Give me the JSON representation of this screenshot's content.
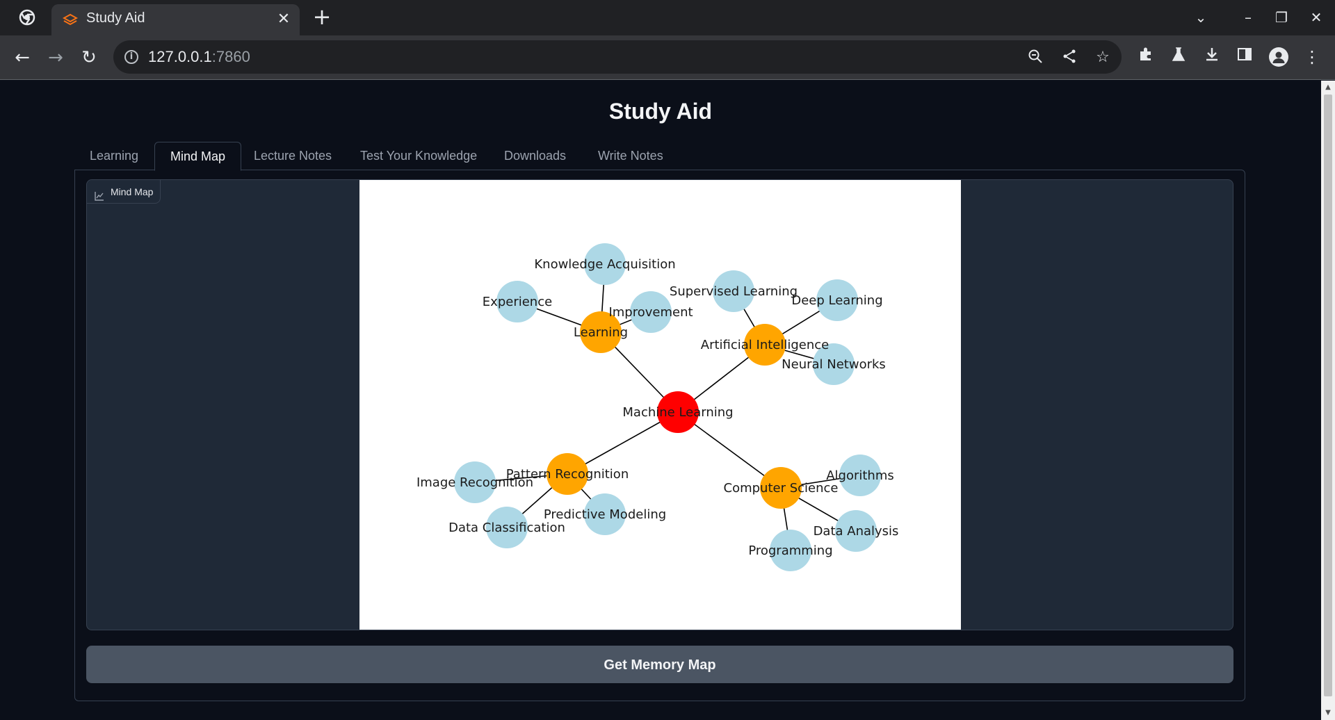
{
  "browser": {
    "tab_title": "Study Aid",
    "tab_close": "✕",
    "new_tab": "+",
    "url_host": "127.0.0.1",
    "url_port": ":7860"
  },
  "app": {
    "title": "Study Aid",
    "tabs": [
      {
        "label": "Learning"
      },
      {
        "label": "Mind Map",
        "active": true
      },
      {
        "label": "Lecture Notes"
      },
      {
        "label": "Test Your Knowledge"
      },
      {
        "label": "Downloads"
      },
      {
        "label": "Write Notes"
      }
    ],
    "plot_label": "Mind Map",
    "button_label": "Get Memory Map"
  },
  "mind_map": {
    "colors": {
      "root": "#ff0000",
      "branch": "#ffa500",
      "leaf": "#add8e6",
      "edge": "#000000"
    },
    "nodes": [
      {
        "id": "ml",
        "label": "Machine Learning",
        "level": "root"
      },
      {
        "id": "learning",
        "label": "Learning",
        "level": "branch"
      },
      {
        "id": "ai",
        "label": "Artificial Intelligence",
        "level": "branch"
      },
      {
        "id": "pr",
        "label": "Pattern Recognition",
        "level": "branch"
      },
      {
        "id": "cs",
        "label": "Computer Science",
        "level": "branch"
      },
      {
        "id": "ka",
        "label": "Knowledge Acquisition",
        "level": "leaf"
      },
      {
        "id": "exp",
        "label": "Experience",
        "level": "leaf"
      },
      {
        "id": "imp",
        "label": "Improvement",
        "level": "leaf"
      },
      {
        "id": "sl",
        "label": "Supervised Learning",
        "level": "leaf"
      },
      {
        "id": "dl",
        "label": "Deep Learning",
        "level": "leaf"
      },
      {
        "id": "nn",
        "label": "Neural Networks",
        "level": "leaf"
      },
      {
        "id": "ir",
        "label": "Image Recognition",
        "level": "leaf"
      },
      {
        "id": "dc",
        "label": "Data Classification",
        "level": "leaf"
      },
      {
        "id": "pm",
        "label": "Predictive Modeling",
        "level": "leaf"
      },
      {
        "id": "alg",
        "label": "Algorithms",
        "level": "leaf"
      },
      {
        "id": "da",
        "label": "Data Analysis",
        "level": "leaf"
      },
      {
        "id": "prog",
        "label": "Programming",
        "level": "leaf"
      }
    ],
    "edges": [
      [
        "ml",
        "learning"
      ],
      [
        "ml",
        "ai"
      ],
      [
        "ml",
        "pr"
      ],
      [
        "ml",
        "cs"
      ],
      [
        "learning",
        "ka"
      ],
      [
        "learning",
        "exp"
      ],
      [
        "learning",
        "imp"
      ],
      [
        "ai",
        "sl"
      ],
      [
        "ai",
        "dl"
      ],
      [
        "ai",
        "nn"
      ],
      [
        "pr",
        "ir"
      ],
      [
        "pr",
        "dc"
      ],
      [
        "pr",
        "pm"
      ],
      [
        "cs",
        "alg"
      ],
      [
        "cs",
        "da"
      ],
      [
        "cs",
        "prog"
      ]
    ]
  }
}
